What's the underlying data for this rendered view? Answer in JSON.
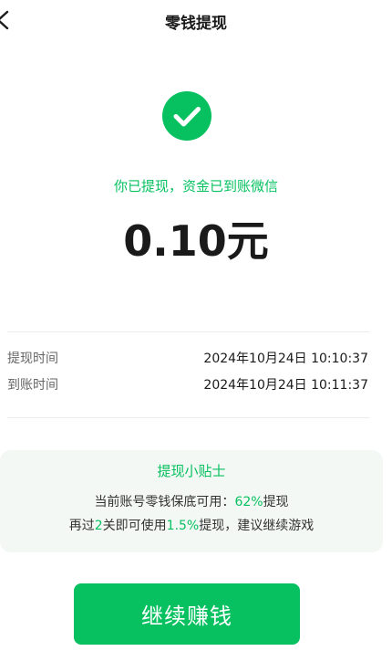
{
  "header": {
    "title": "零钱提现"
  },
  "result": {
    "status_text": "你已提现，资金已到账微信",
    "amount": "0.10元"
  },
  "details": [
    {
      "label": "提现时间",
      "value": "2024年10月24日  10:10:37"
    },
    {
      "label": "到账时间",
      "value": "2024年10月24日  10:11:37"
    }
  ],
  "tips": {
    "title": "提现小贴士",
    "line1_prefix": "当前账号零钱保底可用：",
    "line1_highlight": "62%",
    "line1_suffix": "提现",
    "line2_prefix": "再过",
    "line2_highlight1": "2",
    "line2_middle": "关即可使用",
    "line2_highlight2": "1.5%",
    "line2_suffix": "提现，建议继续游戏"
  },
  "cta": {
    "label": "继续赚钱"
  },
  "colors": {
    "accent": "#07c160",
    "tips_background": "#f4f8f5"
  },
  "icons": {
    "back": "chevron-left-icon",
    "success": "check-circle-icon"
  }
}
